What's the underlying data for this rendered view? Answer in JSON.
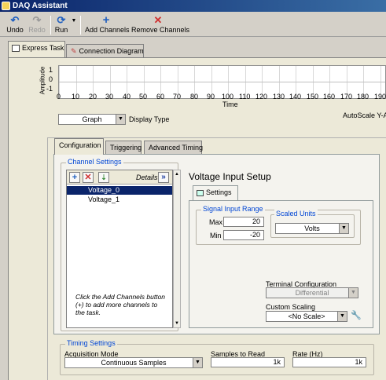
{
  "window": {
    "title": "DAQ Assistant"
  },
  "toolbar": {
    "undo": "Undo",
    "redo": "Redo",
    "run": "Run",
    "add_channels": "Add Channels",
    "remove_channels": "Remove Channels"
  },
  "top_tabs": {
    "express_task": "Express Task",
    "connection_diagram": "Connection Diagram"
  },
  "graph": {
    "ylabel": "Amplitude",
    "xlabel": "Time",
    "y_ticks": [
      "1",
      "0",
      "-1"
    ],
    "x_ticks": [
      "0",
      "10",
      "20",
      "30",
      "40",
      "50",
      "60",
      "70",
      "80",
      "90",
      "100",
      "110",
      "120",
      "130",
      "140",
      "150",
      "160",
      "170",
      "180",
      "190"
    ],
    "display_type_value": "Graph",
    "display_type_label": "Display Type",
    "autoscale_label": "AutoScale Y-Ax"
  },
  "config_tabs": {
    "configuration": "Configuration",
    "triggering": "Triggering",
    "advanced_timing": "Advanced Timing"
  },
  "channel_settings": {
    "title": "Channel Settings",
    "details": "Details",
    "channels": [
      "Voltage_0",
      "Voltage_1"
    ],
    "help_text": "Click the Add Channels button (+) to add more channels to the task."
  },
  "voltage_setup": {
    "title": "Voltage Input Setup",
    "settings_tab": "Settings",
    "signal_range_title": "Signal Input Range",
    "max_label": "Max",
    "max_value": "20",
    "min_label": "Min",
    "min_value": "-20",
    "scaled_units_title": "Scaled Units",
    "scaled_units_value": "Volts",
    "terminal_config_label": "Terminal Configuration",
    "terminal_config_value": "Differential",
    "custom_scaling_label": "Custom Scaling",
    "custom_scaling_value": "<No Scale>"
  },
  "timing": {
    "title": "Timing Settings",
    "acq_mode_label": "Acquisition Mode",
    "acq_mode_value": "Continuous Samples",
    "samples_label": "Samples to Read",
    "samples_value": "1k",
    "rate_label": "Rate (Hz)",
    "rate_value": "1k"
  },
  "colors": {
    "title_bar": "#0a246a",
    "selection": "#0a246a",
    "group_title": "#0046d5",
    "add": "#1f5fbf",
    "remove": "#d03030"
  }
}
